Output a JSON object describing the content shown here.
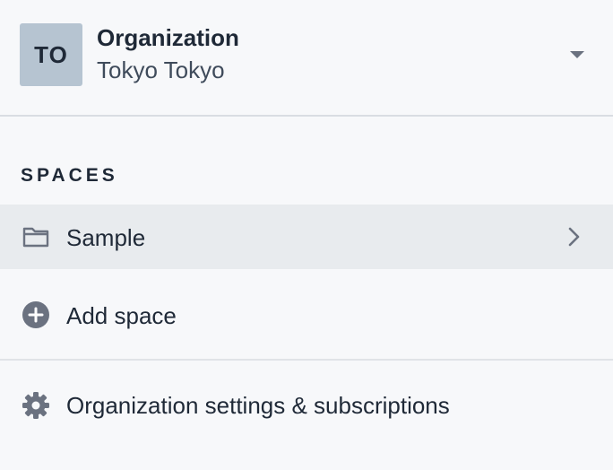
{
  "organization": {
    "avatar_initials": "TO",
    "title": "Organization",
    "name": "Tokyo Tokyo"
  },
  "spaces": {
    "section_label": "SPACES",
    "items": [
      {
        "label": "Sample",
        "icon": "folder-icon",
        "selected": true
      }
    ]
  },
  "actions": {
    "add_space_label": "Add space",
    "settings_label": "Organization settings & subscriptions"
  },
  "colors": {
    "background": "#f7f8fa",
    "avatar_bg": "#b6c4d1",
    "selected_row_bg": "#e8ebee",
    "icon_color": "#6b7280",
    "text_color": "#1f2937"
  }
}
